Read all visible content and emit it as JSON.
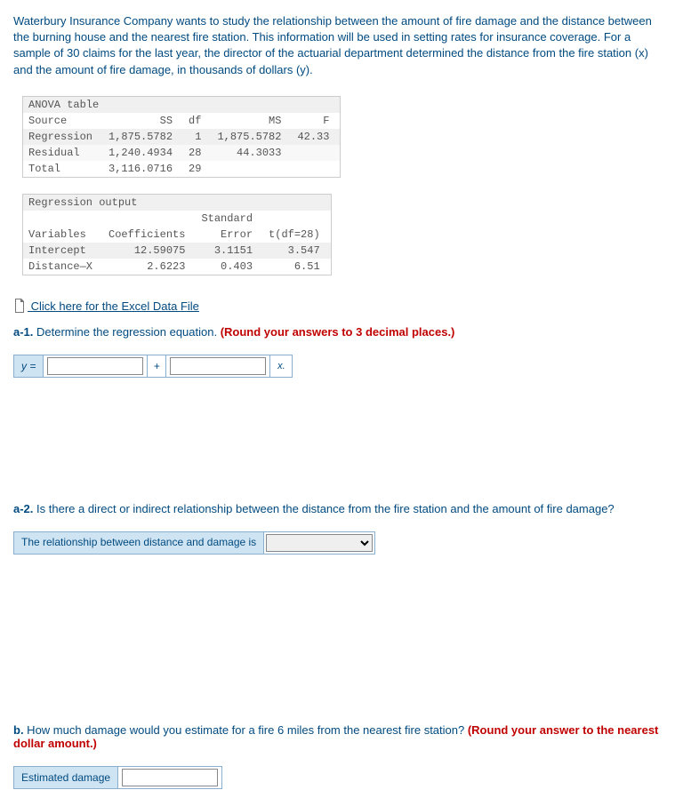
{
  "intro": "Waterbury Insurance Company wants to study the relationship between the amount of fire damage and the distance between the burning house and the nearest fire station. This information will be used in setting rates for insurance coverage. For a sample of 30 claims for the last year, the director of the actuarial department determined the distance from the fire station (x) and the amount of fire damage, in thousands of dollars (y).",
  "anova": {
    "title": "ANOVA table",
    "h_source": "Source",
    "h_ss": "SS",
    "h_df": "df",
    "h_ms": "MS",
    "h_f": "F",
    "rows": [
      {
        "c0": "Regression",
        "c1": "1,875.5782",
        "c2": "1",
        "c3": "1,875.5782",
        "c4": "42.33"
      },
      {
        "c0": "Residual",
        "c1": "1,240.4934",
        "c2": "28",
        "c3": "44.3033",
        "c4": ""
      },
      {
        "c0": "Total",
        "c1": "3,116.0716",
        "c2": "29",
        "c3": "",
        "c4": ""
      }
    ]
  },
  "regout": {
    "title": "Regression output",
    "h_vars": "Variables",
    "h_coef": "Coefficients",
    "h_se1": "Standard",
    "h_se2": "Error",
    "h_t": "t(df=28)",
    "rows": [
      {
        "c0": "Intercept",
        "c1": "12.59075",
        "c2": "3.1151",
        "c3": "3.547"
      },
      {
        "c0": "Distance—X",
        "c1": "2.6223",
        "c2": "0.403",
        "c3": "6.51"
      }
    ]
  },
  "link_text": " Click here for the Excel Data File",
  "q_a1_label": "a-1.",
  "q_a1_text": " Determine the regression equation. ",
  "q_a1_red": "(Round your answers to 3 decimal places.)",
  "y_eq": "y =",
  "plus": "+",
  "xsuffix": "x.",
  "q_a2_label": "a-2.",
  "q_a2_text": " Is there a direct or indirect relationship between the distance from the fire station and the amount of fire damage?",
  "select_label": "The relationship between distance and damage is",
  "q_b_label": "b.",
  "q_b_text": " How much damage would you estimate for a fire 6 miles from the nearest fire station? ",
  "q_b_red": "(Round your answer to the nearest dollar amount.)",
  "est_label": "Estimated damage"
}
